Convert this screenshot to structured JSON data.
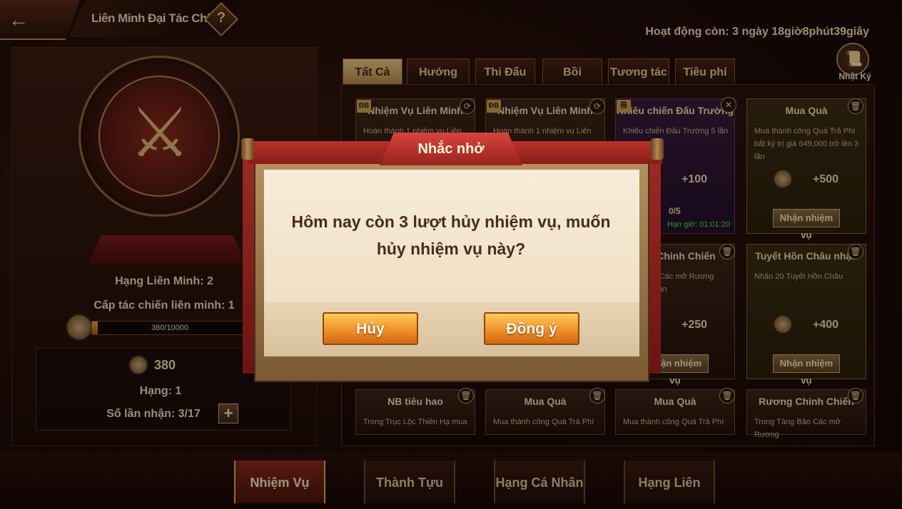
{
  "header": {
    "title": "Liên Minh Đại Tác Chiến",
    "help_glyph": "?",
    "timer_text": "Hoạt động còn: 3 ngày 18giờ8phút39giây"
  },
  "left_panel": {
    "rank_text": "Hạng Liên Minh: 2",
    "level_text": "Cấp tác chiến liên minh: 1",
    "progress_text": "380/10000",
    "progress_fraction": 0.038,
    "points": "380",
    "hang_text": "Hạng: 1",
    "times_text": "Số lần nhận: 3/17",
    "plus_label": "+"
  },
  "tabs": [
    {
      "label": "Tất Cả",
      "active": true
    },
    {
      "label": "Hướng Dẫn",
      "active": false
    },
    {
      "label": "Thi Đấu",
      "active": false
    },
    {
      "label": "Bồi Dưỡng",
      "active": false
    },
    {
      "label": "Tương tác",
      "active": false
    },
    {
      "label": "Tiêu phí",
      "active": false
    }
  ],
  "diary": {
    "label": "Nhật Ký",
    "icon": "scroll-icon"
  },
  "cards": [
    {
      "title": "Nhiệm Vụ Liên Minh",
      "desc": "Hoàn thành 1 nhiệm vụ Liên",
      "badge": "ĐB"
    },
    {
      "title": "Nhiệm Vụ Liên Minh",
      "desc": "Hoàn thành 1 nhiệm vụ Liên",
      "badge": "ĐB"
    },
    {
      "title": "Khiêu chiến Đấu Trường",
      "desc": "Khiêu chiến Đấu Trường 5 lần",
      "reward": "+100",
      "progress": "0/5",
      "deadline": "Hạn giờ: 01:01:20",
      "badge": "冊"
    },
    {
      "title": "Mua Quà",
      "desc": "Mua thành công Quà Trả Phí bất kỳ trị giá 649,000 trở lên 3 lần",
      "reward": "+500",
      "button": "Nhận nhiệm vụ"
    },
    {
      "title": "ơng Chinh Chiến",
      "desc": "Tàng Bảo Các mở Rương Chiến 50 lần",
      "reward": "+250",
      "button": "Nhận nhiệm vụ"
    },
    {
      "title": "Tuyết Hồn Châu nhận",
      "desc": "Nhận 20 Tuyết Hồn Châu",
      "reward": "+400",
      "button": "Nhận nhiệm vụ"
    },
    {
      "title": "NB tiêu hao",
      "desc": "Trong Trục Lộc Thiên Hạ mua"
    },
    {
      "title": "Mua Quà",
      "desc": "Mua thành công Quà Trả Phí"
    },
    {
      "title": "Mua Quà",
      "desc": "Mua thành công Quà Trả Phí"
    },
    {
      "title": "Rương Chinh Chiến",
      "desc": "Trong Tàng Bảo Các mở Rương"
    }
  ],
  "bottom_tabs": [
    {
      "label": "Nhiệm Vụ",
      "active": true
    },
    {
      "label": "Thành Tựu",
      "active": false
    },
    {
      "label": "Hạng Cá Nhân",
      "active": false
    },
    {
      "label": "Hạng Liên Minh",
      "active": false
    }
  ],
  "modal": {
    "title": "Nhắc nhở",
    "message": "Hôm nay còn 3 lượt hủy nhiệm vụ, muốn hủy nhiệm vụ này?",
    "cancel_label": "Hủy",
    "confirm_label": "Đồng ý"
  },
  "icons": {
    "back": "←",
    "refresh": "⟳",
    "close": "✕",
    "trash": "🗑"
  },
  "colors": {
    "accent_gold": "#e8c888",
    "button_orange": "#f0902a",
    "deadline_green": "#58e048",
    "modal_red": "#9a2a24"
  }
}
